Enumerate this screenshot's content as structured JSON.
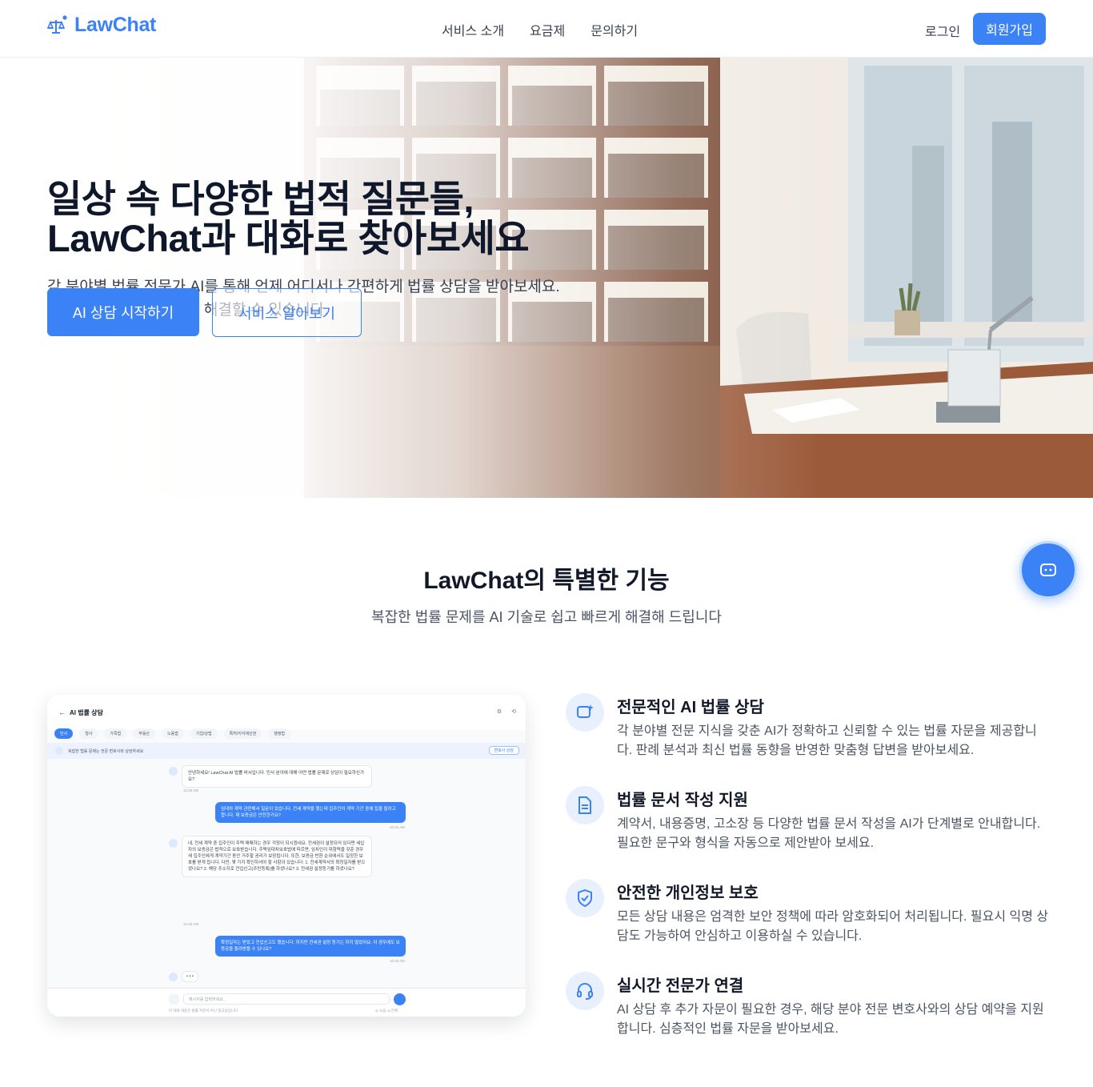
{
  "header": {
    "brand": "LawChat",
    "nav": [
      "서비스 소개",
      "요금제",
      "문의하기"
    ],
    "login": "로그인",
    "signup": "회원가입"
  },
  "hero": {
    "title_line1": "일상 속 다양한 법적 질문들,",
    "title_line2": "LawChat과 대화로 찾아보세요",
    "subtitle": "각 분야별 법률 전문가 AI를 통해 언제 어디서나 간편하게 법률 상담을 받아보세요. 복잡한 법률 문제도 쉽게 해결할 수 있습니다.",
    "cta_primary": "AI 상담 시작하기",
    "cta_secondary": "서비스 알아보기"
  },
  "features_section": {
    "title": "LawChat의 특별한 기능",
    "subtitle": "복잡한 법률 문제를 AI 기술로 쉽고 빠르게 해결해 드립니다"
  },
  "mock_chat": {
    "back": "←",
    "title": "AI 법률 상담",
    "tabs": [
      "민사",
      "형사",
      "가족법",
      "부동산",
      "노동법",
      "기업/상법",
      "특허/지식재산권",
      "행정법"
    ],
    "banner": "복잡한 법률 문제는 전문 변호사와 상담하세요",
    "banner_button": "변호사 상담",
    "messages": [
      {
        "role": "ai",
        "text": "안녕하세요! LawChat AI 법률 비서입니다. 민사 분야에 대해 어떤 법률 문제로 상담이 필요하신가요?",
        "time": "12:30 AM"
      },
      {
        "role": "user",
        "text": "임대차 계약 관련해서 질문이 있습니다. 전세 계약을 했는데 집주인이 계약 기간 중에 집을 팔려고 합니다. 제 보증금은 안전한가요?",
        "time": "10:31 AM"
      },
      {
        "role": "ai",
        "text": "네, 전세 계약 중 집주인이 주택 매매하는 경우 걱정이 되시겠네요. 전세권이 설정되어 있다면 세입자의 보증금은 법적으로 보호받습니다. 주택임대차보호법에 따르면, 임차인이 대항력을 갖춘 경우 새 집주인에게 계약기간 동안 거주할 권리가 보장됩니다. 또한, 보증금 반환 순위에서도 일정한 보호를 받게 됩니다. 다만, 몇 가지 확인하셔야 할 사항이 있습니다: 1. 전세계약서의 확정일자를 받으셨나요? 2. 해당 주소지로 전입신고(주민등록)를 하셨나요? 3. 전세권 설정등기를 하셨나요?",
        "time": "12:32 AM"
      },
      {
        "role": "user",
        "text": "확정일자는 받았고 전입신고도 했습니다. 하지만 전세권 설정 등기는 하지 않았어요. 이 경우에도 보증금을 돌려받을 수 있나요?",
        "time": "10:33 AM"
      }
    ],
    "typing": "• • •",
    "input_placeholder": "메시지를 입력하세요...",
    "footer": "이 대화 내용은 법률 자문이 아닌 참고용입니다",
    "footer_right": "◎ 녹음   ⇲ 전체"
  },
  "features": [
    {
      "icon": "chat-sparkle-icon",
      "title": "전문적인 AI 법률 상담",
      "desc": "각 분야별 전문 지식을 갖춘 AI가 정확하고 신뢰할 수 있는 법률 자문을 제공합니다. 판례 분석과 최신 법률 동향을 반영한 맞춤형 답변을 받아보세요."
    },
    {
      "icon": "document-icon",
      "title": "법률 문서 작성 지원",
      "desc": "계약서, 내용증명, 고소장 등 다양한 법률 문서 작성을 AI가 단계별로 안내합니다. 필요한 문구와 형식을 자동으로 제안받아 보세요."
    },
    {
      "icon": "shield-check-icon",
      "title": "안전한 개인정보 보호",
      "desc": "모든 상담 내용은 엄격한 보안 정책에 따라 암호화되어 처리됩니다. 필요시 익명 상담도 가능하여 안심하고 이용하실 수 있습니다."
    },
    {
      "icon": "headset-icon",
      "title": "실시간 전문가 연결",
      "desc": "AI 상담 후 추가 자문이 필요한 경우, 해당 분야 전문 변호사와의 상담 예약을 지원합니다. 심층적인 법률 자문을 받아보세요."
    }
  ],
  "colors": {
    "accent": "#3b82f6",
    "heading": "#0f172a",
    "muted": "#4b5563"
  }
}
